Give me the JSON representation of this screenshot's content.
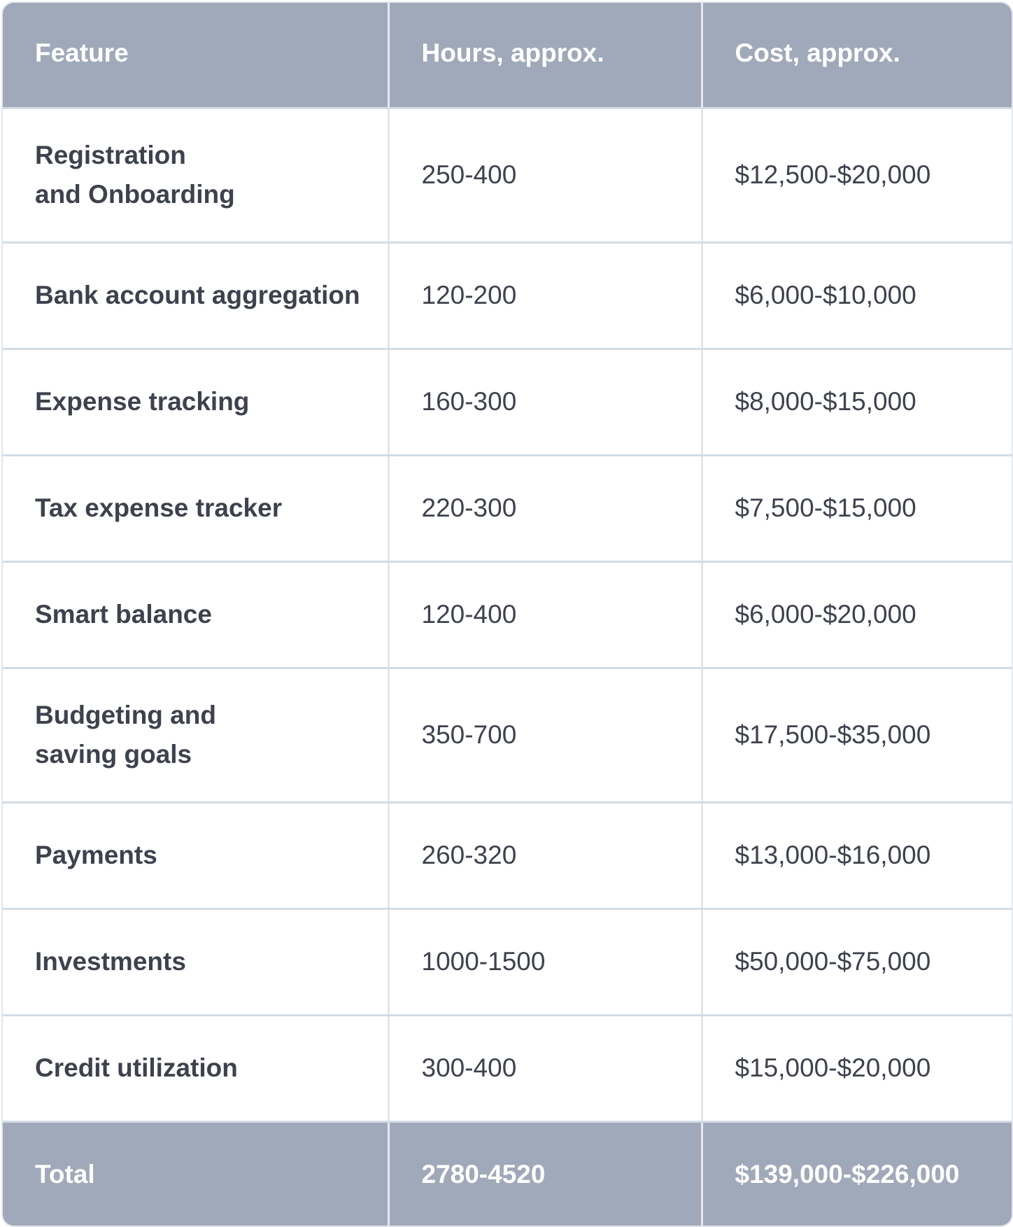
{
  "table": {
    "headers": [
      "Feature",
      "Hours, approx.",
      "Cost, approx."
    ],
    "rows": [
      {
        "feature": "Registration\nand Onboarding",
        "hours": "250-400",
        "cost": "$12,500-$20,000"
      },
      {
        "feature": "Bank account aggregation",
        "hours": "120-200",
        "cost": "$6,000-$10,000"
      },
      {
        "feature": "Expense tracking",
        "hours": "160-300",
        "cost": "$8,000-$15,000"
      },
      {
        "feature": "Tax expense tracker",
        "hours": "220-300",
        "cost": "$7,500-$15,000"
      },
      {
        "feature": "Smart balance",
        "hours": "120-400",
        "cost": "$6,000-$20,000"
      },
      {
        "feature": "Budgeting and\nsaving goals",
        "hours": "350-700",
        "cost": "$17,500-$35,000"
      },
      {
        "feature": "Payments",
        "hours": "260-320",
        "cost": "$13,000-$16,000"
      },
      {
        "feature": "Investments",
        "hours": "1000-1500",
        "cost": "$50,000-$75,000"
      },
      {
        "feature": "Credit utilization",
        "hours": "300-400",
        "cost": "$15,000-$20,000"
      }
    ],
    "total": {
      "label": "Total",
      "hours": "2780-4520",
      "cost": "$139,000-$226,000"
    }
  },
  "colors": {
    "header_bg": "#a0a9b9",
    "header_text": "#ffffff",
    "body_text": "#3d424d",
    "border": "#d3dce5"
  }
}
